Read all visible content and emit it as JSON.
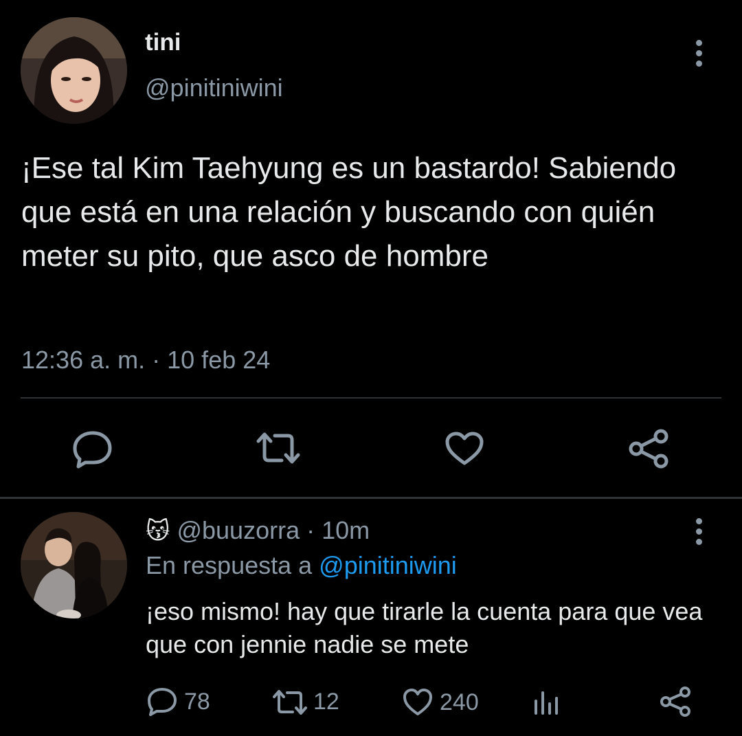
{
  "tweet": {
    "display_name": "tini",
    "handle": "@pinitiniwini",
    "text": "¡Ese tal Kim Taehyung es un bastardo! Sabiendo que está en una relación y buscando con quién meter su pito, que asco de hombre",
    "time": "12:36 a. m.",
    "separator": "·",
    "date": "10 feb 24"
  },
  "actions": {
    "icons": [
      "reply-icon",
      "retweet-icon",
      "like-icon",
      "share-icon"
    ]
  },
  "reply": {
    "emoji": "😽",
    "handle": "@buuzorra",
    "separator": "·",
    "time": "10m",
    "replying_prefix": "En respuesta a",
    "replying_to": "@pinitiniwini",
    "text": "¡eso mismo! hay que tirarle la cuenta para que vea que con jennie nadie se mete",
    "stats": {
      "replies": "78",
      "retweets": "12",
      "likes": "240"
    }
  },
  "colors": {
    "background": "#000000",
    "text": "#e7e9ea",
    "muted": "#8b98a5",
    "link": "#1d9bf0",
    "divider": "#2f3336"
  }
}
